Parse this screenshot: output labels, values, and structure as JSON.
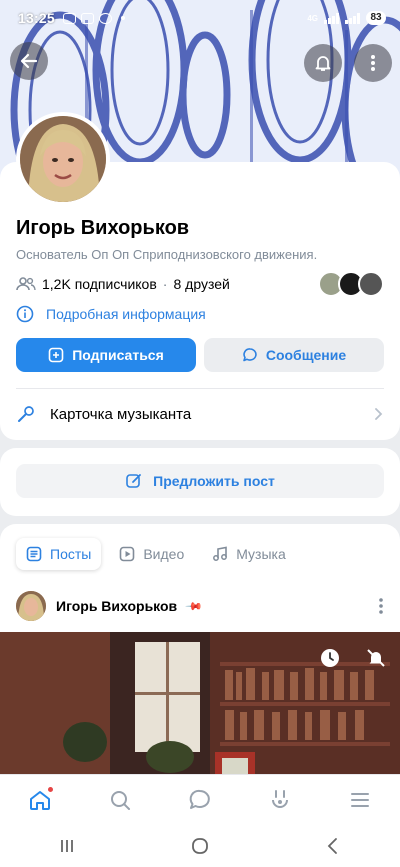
{
  "status_bar": {
    "time": "13:25",
    "network": "4G",
    "battery": "83"
  },
  "profile": {
    "name": "Игорь Вихорьков",
    "status": "Основатель Оп Оп Сприподнизовского движения.",
    "subscribers": "1,2K подписчиков",
    "separator": "·",
    "friends": "8 друзей",
    "more_info": "Подробная информация",
    "subscribe_label": "Подписаться",
    "message_label": "Сообщение",
    "music_card": "Карточка музыканта"
  },
  "suggest": {
    "label": "Предложить пост"
  },
  "feed": {
    "tabs": [
      {
        "label": "Посты",
        "active": true
      },
      {
        "label": "Видео",
        "active": false
      },
      {
        "label": "Музыка",
        "active": false
      }
    ],
    "post": {
      "author": "Игорь Вихорьков"
    }
  },
  "bottom_nav": [
    "home-icon",
    "search-icon",
    "messages-icon",
    "clips-icon",
    "menu-icon"
  ],
  "colors": {
    "accent": "#2688eb",
    "link": "#2d81e0",
    "background": "#ebedf0",
    "notification_dot": "#e64646"
  }
}
